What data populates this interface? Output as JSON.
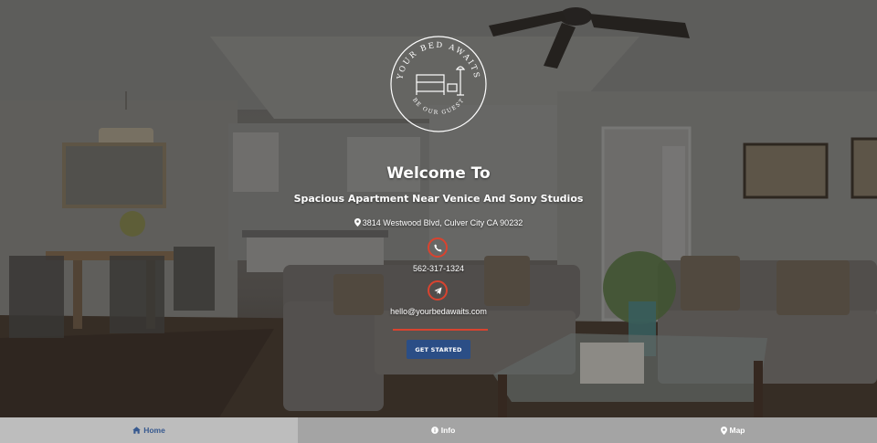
{
  "hero": {
    "logo_top_text": "YOUR BED AWAITS",
    "logo_bottom_text": "BE OUR GUEST",
    "welcome": "Welcome To",
    "subtitle": "Spacious Apartment Near Venice And Sony Studios",
    "address": "3814 Westwood Blvd, Culver City CA 90232",
    "phone": "562-317-1324",
    "email": "hello@yourbedawaits.com",
    "cta_label": "GET STARTED",
    "icons": {
      "address": "map-marker-icon",
      "phone": "phone-icon",
      "email": "paper-plane-icon"
    },
    "colors": {
      "accent": "#d9432f",
      "cta": "#2b4e86"
    }
  },
  "nav": {
    "items": [
      {
        "label": "Home",
        "icon": "home-icon",
        "active": true
      },
      {
        "label": "Info",
        "icon": "info-icon",
        "active": false
      },
      {
        "label": "Map",
        "icon": "map-marker-icon",
        "active": false
      }
    ],
    "colors": {
      "active_bg": "#bdbdbd",
      "active_text": "#37598f",
      "inactive_bg": "#a4a4a4"
    }
  }
}
